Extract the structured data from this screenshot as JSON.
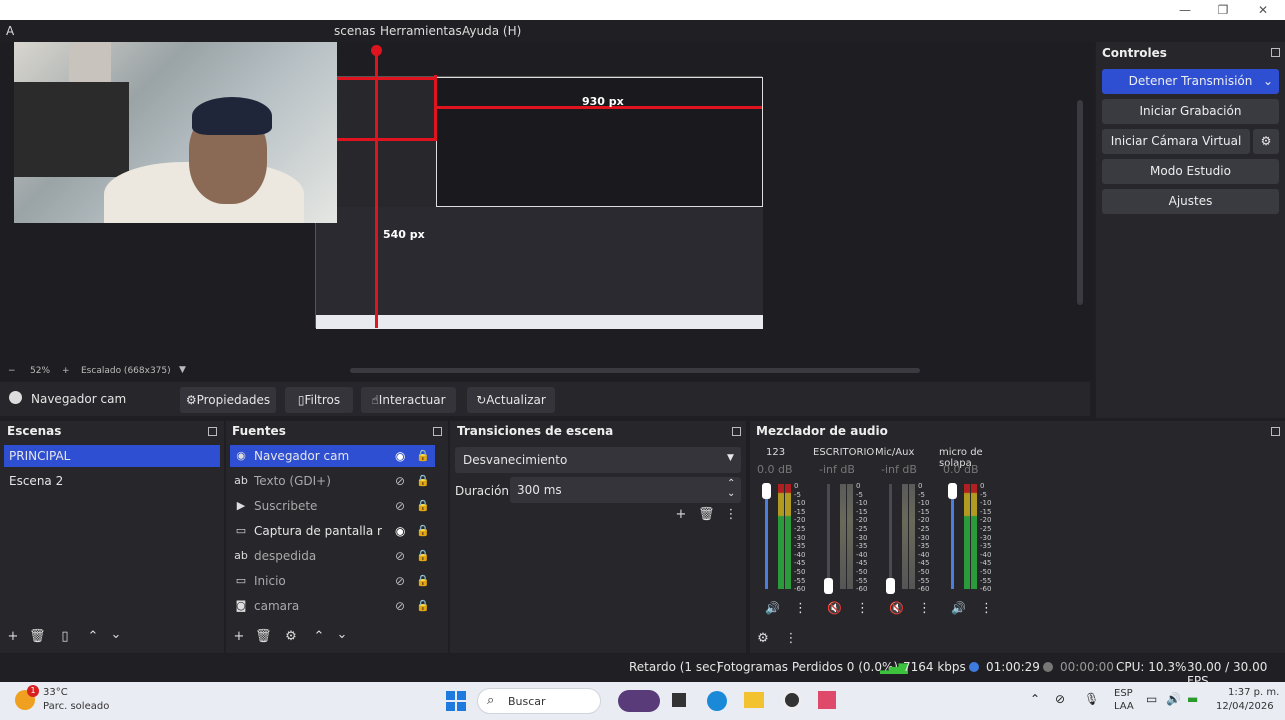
{
  "titlebar": {
    "minimize": "—",
    "maximize": "❐",
    "close": "✕"
  },
  "menubar": {
    "partial_first": "A",
    "items": [
      "scenas",
      "Herramientas",
      "Ayuda (H)"
    ]
  },
  "preview": {
    "label_930": "930 px",
    "label_540": "540 px"
  },
  "zoom": {
    "minus": "−",
    "percent": "52%",
    "plus": "+",
    "scaled": "Escalado (668x375)"
  },
  "source_toolbar": {
    "source_name": "Navegador cam",
    "properties": "Propiedades",
    "filters": "Filtros",
    "interact": "Interactuar",
    "refresh": "Actualizar"
  },
  "controls": {
    "title": "Controles",
    "stop_stream": "Detener Transmisión",
    "start_recording": "Iniciar Grabación",
    "virtual_camera": "Iniciar Cámara Virtual",
    "studio_mode": "Modo Estudio",
    "settings": "Ajustes"
  },
  "scenes": {
    "title": "Escenas",
    "items": [
      "PRINCIPAL",
      "Escena 2"
    ]
  },
  "sources": {
    "title": "Fuentes",
    "items": [
      {
        "label": "Navegador cam",
        "icon": "globe-icon"
      },
      {
        "label": "Texto (GDI+)",
        "icon": "text-icon"
      },
      {
        "label": "Suscribete",
        "icon": "play-icon"
      },
      {
        "label": "Captura de pantalla  r",
        "icon": "monitor-icon"
      },
      {
        "label": "despedida",
        "icon": "text-icon"
      },
      {
        "label": "Inicio",
        "icon": "window-icon"
      },
      {
        "label": "camara",
        "icon": "camera-icon"
      }
    ]
  },
  "transitions": {
    "title": "Transiciones de escena",
    "selected": "Desvanecimiento",
    "duration_label": "Duración",
    "duration_value": "300 ms"
  },
  "mixer": {
    "title": "Mezclador de audio",
    "channels": [
      {
        "name": "123",
        "db": "0.0 dB",
        "muted": false
      },
      {
        "name": "ESCRITORIO",
        "db": "-inf dB",
        "muted": true
      },
      {
        "name": "Mic/Aux",
        "db": "-inf dB",
        "muted": true
      },
      {
        "name": "micro de solapa",
        "db": "0.0 dB",
        "muted": false
      }
    ],
    "scale": [
      "0",
      "-5",
      "-10",
      "-15",
      "-20",
      "-25",
      "-30",
      "-35",
      "-40",
      "-45",
      "-50",
      "-55",
      "-60"
    ]
  },
  "status": {
    "delay": "Retardo (1 sec)",
    "dropped": "Fotogramas Perdidos 0 (0.0%)",
    "bitrate": "7164 kbps",
    "stream_time": "01:00:29",
    "rec_time": "00:00:00",
    "cpu": "CPU: 10.3%",
    "fps": "30.00 / 30.00 FPS"
  },
  "taskbar": {
    "badge": "1",
    "temp": "33°C",
    "weather": "Parc. soleado",
    "search": "Buscar",
    "lang1": "ESP",
    "lang2": "LAA",
    "time": "1:37 p. m.",
    "date": "12/04/2026"
  },
  "colors": {
    "accent": "#2f4fd3",
    "red": "#e0141e",
    "panel": "#26262b"
  }
}
